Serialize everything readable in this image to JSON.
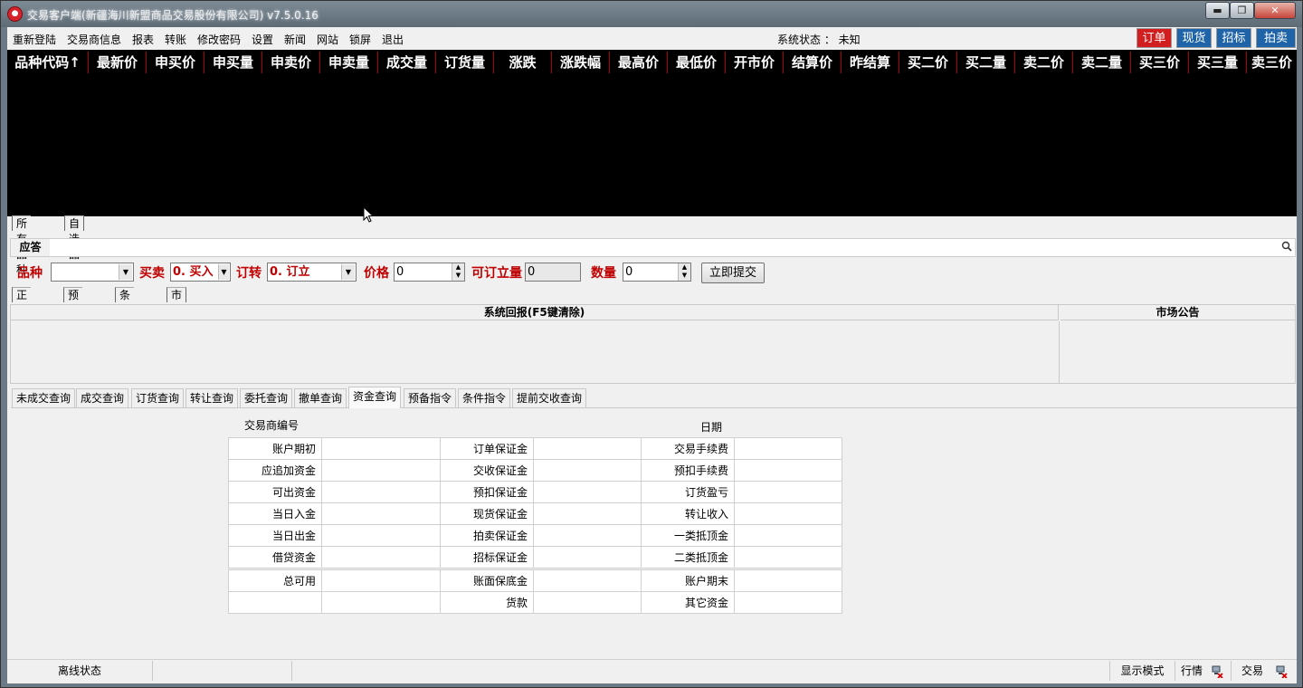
{
  "window": {
    "title": "交易客户端(新疆海川新盟商品交易股份有限公司) v7.5.0.16",
    "minimize_glyph": "▬",
    "maximize_glyph": "❐",
    "close_glyph": "✕"
  },
  "menu": {
    "items": [
      "重新登陆",
      "交易商信息",
      "报表",
      "转账",
      "修改密码",
      "设置",
      "新闻",
      "网站",
      "锁屏",
      "退出"
    ],
    "system_status": "系统状态 ： 未知"
  },
  "modes": [
    {
      "label": "订单",
      "color": "#d21e1e"
    },
    {
      "label": "现货",
      "color": "#1f64a8"
    },
    {
      "label": "招标",
      "color": "#1f64a8"
    },
    {
      "label": "拍卖",
      "color": "#1f64a8"
    }
  ],
  "market": {
    "columns": [
      "品种代码↑",
      "最新价",
      "申买价",
      "申买量",
      "申卖价",
      "申卖量",
      "成交量",
      "订货量",
      "涨跌",
      "涨跌幅",
      "最高价",
      "最低价",
      "开市价",
      "结算价",
      "昨结算",
      "买二价",
      "买二量",
      "卖二价",
      "卖二量",
      "买三价",
      "买三量",
      "卖三价"
    ]
  },
  "product_tabs": [
    "所有品种",
    "自选品种"
  ],
  "response": {
    "label": "应答"
  },
  "order": {
    "product_label": "品种",
    "product_value": "",
    "side_label": "买卖",
    "side_value": "0. 买入",
    "type_label": "订转",
    "type_value": "0. 订立",
    "price_label": "价格",
    "price_value": "0",
    "available_label": "可订立量",
    "available_value": "0",
    "qty_label": "数量",
    "qty_value": "0",
    "submit_label": "立即提交"
  },
  "entry_tabs": [
    "正常委托",
    "预备指令",
    "条件委托",
    "市价委托"
  ],
  "report": {
    "system_report_title": "系统回报(F5键清除)",
    "market_notice_title": "市场公告"
  },
  "query_tabs": [
    "未成交查询",
    "成交查询",
    "订货查询",
    "转让查询",
    "委托查询",
    "撤单查询",
    "资金查询",
    "预备指令",
    "条件指令",
    "提前交收查询"
  ],
  "active_query_tab": "资金查询",
  "fund": {
    "broker_label": "交易商编号",
    "date_label": "日期",
    "rows": [
      [
        "账户期初",
        "订单保证金",
        "交易手续费"
      ],
      [
        "应追加资金",
        "交收保证金",
        "预扣手续费"
      ],
      [
        "可出资金",
        "预扣保证金",
        "订货盈亏"
      ],
      [
        "当日入金",
        "现货保证金",
        "转让收入"
      ],
      [
        "当日出金",
        "拍卖保证金",
        "一类抵顶金"
      ],
      [
        "借贷资金",
        "招标保证金",
        "二类抵顶金"
      ]
    ],
    "rows2": [
      [
        "总可用",
        "账面保底金",
        "账户期末"
      ],
      [
        "",
        "货款",
        "其它资金"
      ]
    ]
  },
  "statusbar": {
    "offline": "离线状态",
    "display_mode": "显示模式",
    "quote": "行情",
    "trade": "交易"
  }
}
